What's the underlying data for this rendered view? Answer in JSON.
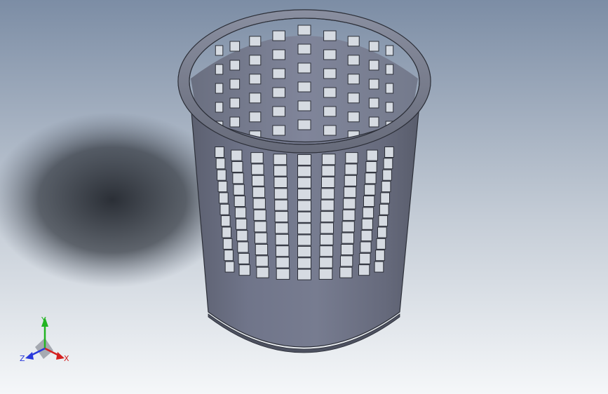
{
  "app": {
    "type": "cad-3d-viewport"
  },
  "model": {
    "name_visible": false,
    "object": "perforated-cylindrical-basket",
    "body_color": "#6e7280",
    "hole_color": "#d6dbe2",
    "rim_color": "#7a7e8c",
    "hole_rows_visible": 12,
    "hole_columns_visible": 9
  },
  "background": {
    "top_color": "#7f8fa6",
    "bottom_color": "#f4f6f8",
    "shadow_color": "#2b2f36"
  },
  "triad": {
    "x_label": "X",
    "y_label": "Y",
    "z_label": "Z",
    "x_color": "#d42020",
    "y_color": "#22b422",
    "z_color": "#2a3adc"
  }
}
